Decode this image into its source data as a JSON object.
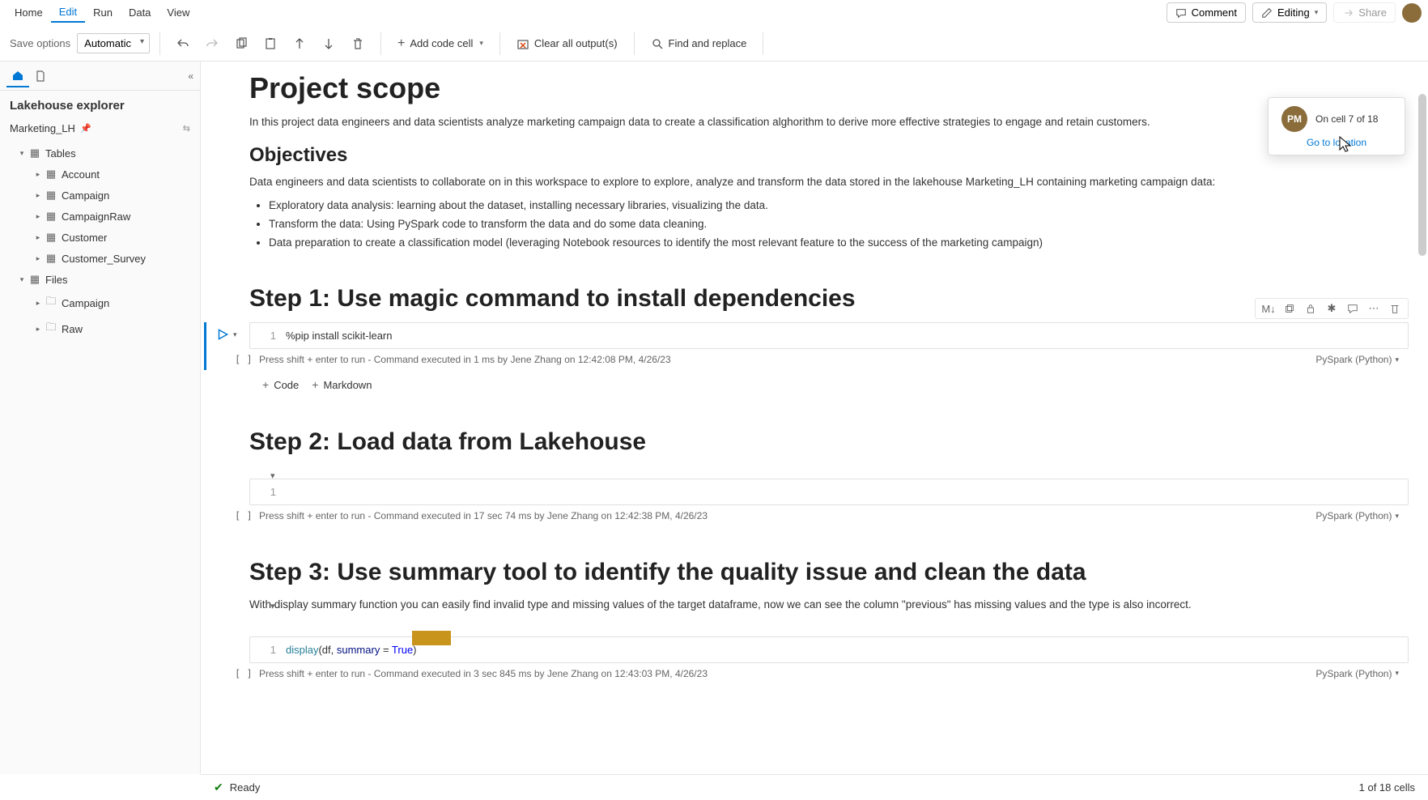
{
  "menu": {
    "home": "Home",
    "edit": "Edit",
    "run": "Run",
    "data": "Data",
    "view": "View",
    "comment": "Comment",
    "editing": "Editing",
    "share": "Share"
  },
  "toolbar": {
    "save_label": "Save options",
    "save_value": "Automatic",
    "add_code": "Add code cell",
    "clear_output": "Clear all output(s)",
    "find_replace": "Find and replace"
  },
  "sidebar": {
    "title": "Lakehouse explorer",
    "lakehouse": "Marketing_LH",
    "tables_label": "Tables",
    "tables": [
      "Account",
      "Campaign",
      "CampaignRaw",
      "Customer",
      "Customer_Survey"
    ],
    "files_label": "Files",
    "files": [
      "Campaign",
      "Raw"
    ]
  },
  "presence": {
    "initials": "PM",
    "cell_text": "On cell 7 of 18",
    "go_to": "Go to location"
  },
  "notebook": {
    "h1": "Project scope",
    "intro": "In this project data engineers and data scientists analyze marketing campaign data to create a classification alghorithm to derive more effective strategies to engage and retain customers.",
    "objectives_h": "Objectives",
    "objectives_p": "Data engineers and data scientists to collaborate on in this workspace to explore to explore, analyze and transform the data stored in the lakehouse Marketing_LH containing marketing campaign data:",
    "bullets": [
      "Exploratory data analysis: learning about the dataset, installing necessary libraries, visualizing the data.",
      "Transform the data: Using PySpark code to transform the data and do some data cleaning.",
      "Data preparation to create a classification model (leveraging Notebook resources to identify the most relevant feature to the success of the marketing campaign)"
    ],
    "step1_h": "Step 1: Use magic command to install dependencies",
    "step1_code": "%pip install scikit-learn",
    "step1_meta_hint": "Press shift + enter to run",
    "step1_meta_exec": "Command executed in 1 ms by Jene Zhang on 12:42:08 PM, 4/26/23",
    "step2_h": "Step 2: Load data from Lakehouse",
    "step2_code": "",
    "step2_meta_hint": "Press shift + enter to run",
    "step2_meta_exec": "Command executed in 17 sec 74 ms by Jene Zhang on 12:42:38 PM, 4/26/23",
    "step3_h": "Step 3: Use summary tool to identify the quality issue and clean the data",
    "step3_p": "With display summary function you can easily find invalid type and missing values of the target dataframe, now we can see the column \"previous\" has missing values and the type is also incorrect.",
    "step3_code": "display(df, summary = True)",
    "step3_meta_hint": "Press shift + enter to run",
    "step3_meta_exec": "Command executed in 3 sec 845 ms by Jene Zhang on 12:43:03 PM, 4/26/23",
    "kernel": "PySpark (Python)",
    "add_code": "Code",
    "add_markdown": "Markdown",
    "cell_toolbar_md": "M↓"
  },
  "status": {
    "ready": "Ready",
    "cells": "1 of 18 cells"
  }
}
